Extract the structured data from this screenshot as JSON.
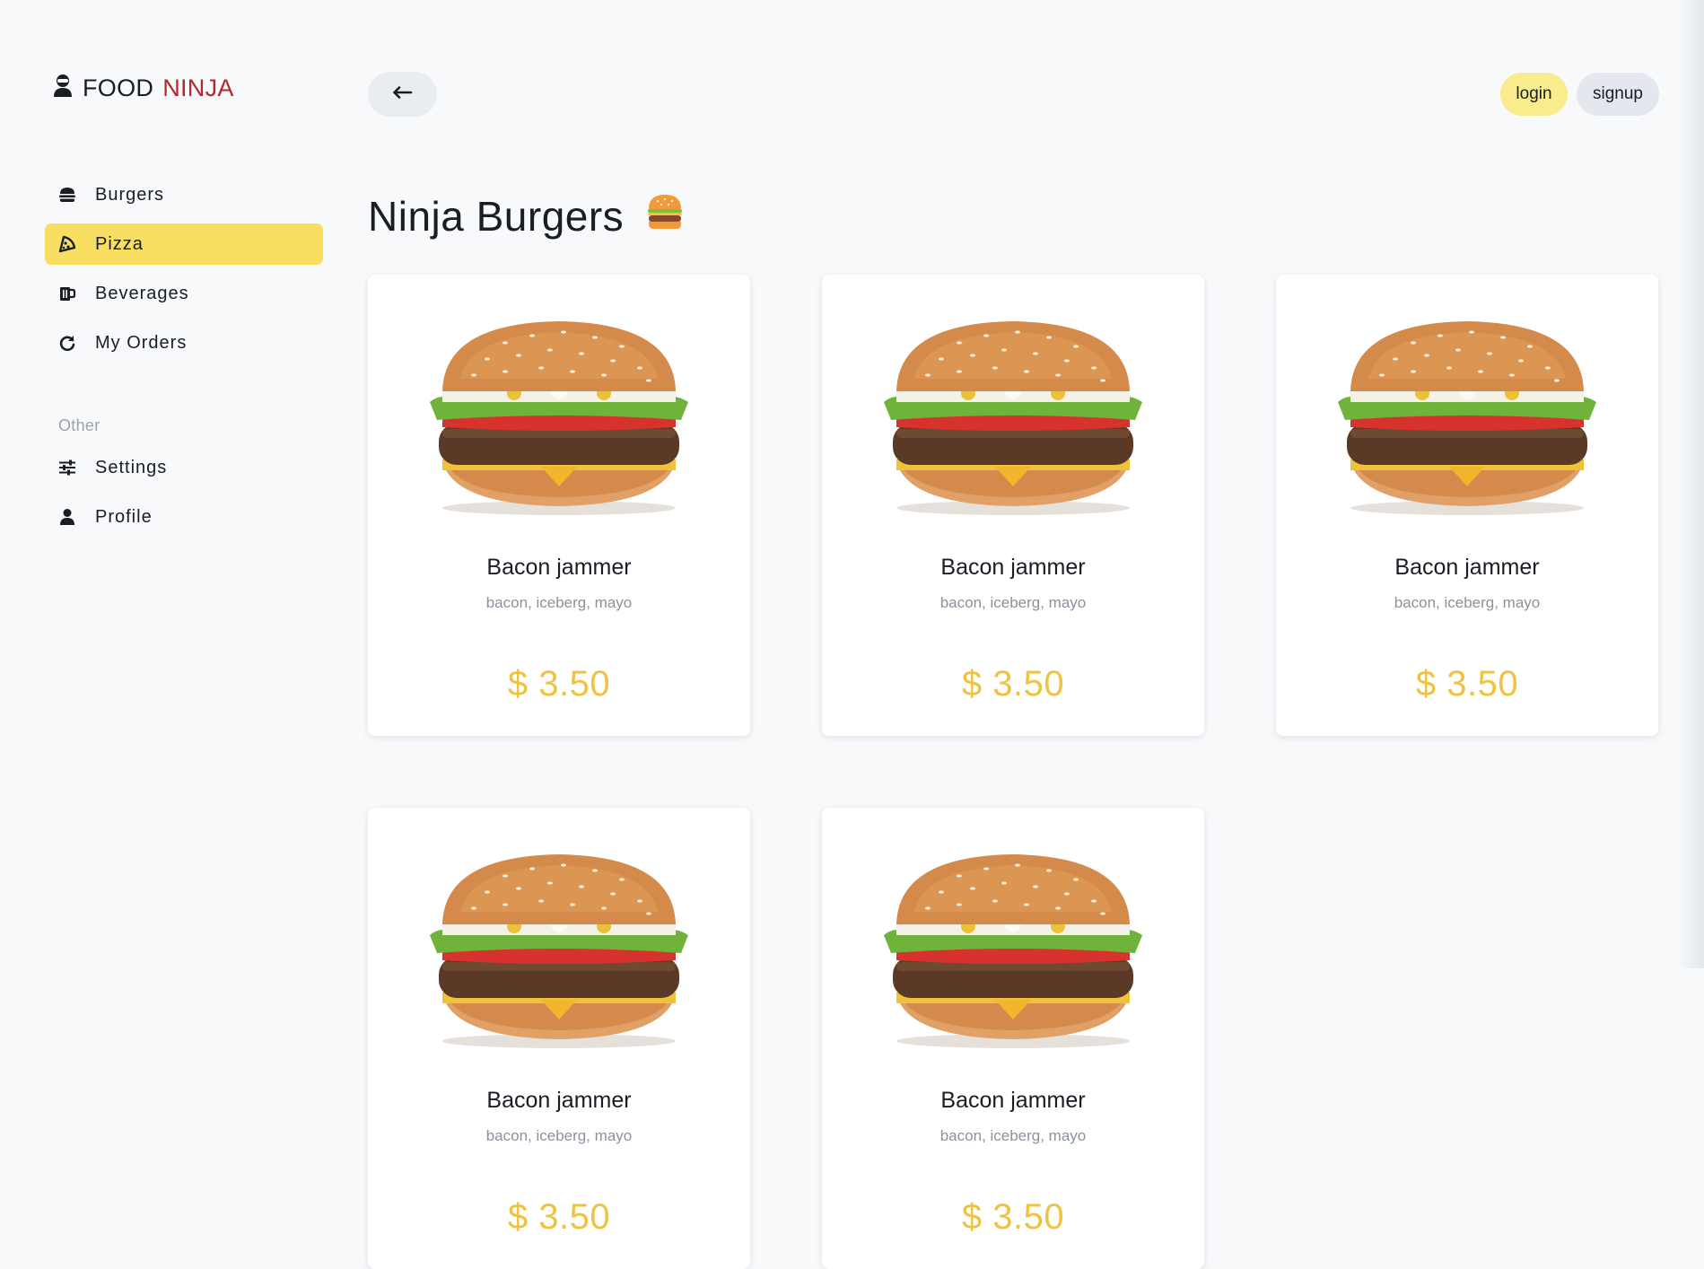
{
  "brand": {
    "part1": "FOOD",
    "part2": "NINJA"
  },
  "sidebar": {
    "items": [
      {
        "label": "Burgers",
        "icon": "hamburger-icon",
        "active": false
      },
      {
        "label": "Pizza",
        "icon": "pizza-slice-icon",
        "active": true
      },
      {
        "label": "Beverages",
        "icon": "beer-mug-icon",
        "active": false
      },
      {
        "label": "My Orders",
        "icon": "redo-arrow-icon",
        "active": false
      }
    ],
    "section_label": "Other",
    "other_items": [
      {
        "label": "Settings",
        "icon": "sliders-icon"
      },
      {
        "label": "Profile",
        "icon": "user-icon"
      }
    ]
  },
  "header": {
    "back_icon": "arrow-left-icon",
    "login_label": "login",
    "signup_label": "signup"
  },
  "main": {
    "title": "Ninja Burgers",
    "title_emoji": "burger-emoji-icon",
    "products": [
      {
        "name": "Bacon jammer",
        "desc": "bacon, iceberg, mayo",
        "price": "$ 3.50"
      },
      {
        "name": "Bacon jammer",
        "desc": "bacon, iceberg, mayo",
        "price": "$ 3.50"
      },
      {
        "name": "Bacon jammer",
        "desc": "bacon, iceberg, mayo",
        "price": "$ 3.50"
      },
      {
        "name": "Bacon jammer",
        "desc": "bacon, iceberg, mayo",
        "price": "$ 3.50"
      },
      {
        "name": "Bacon jammer",
        "desc": "bacon, iceberg, mayo",
        "price": "$ 3.50"
      }
    ]
  },
  "colors": {
    "accent_yellow": "#f8df62",
    "price_yellow": "#eec343",
    "brand_red": "#b3282d",
    "background": "#f7f9fb"
  }
}
